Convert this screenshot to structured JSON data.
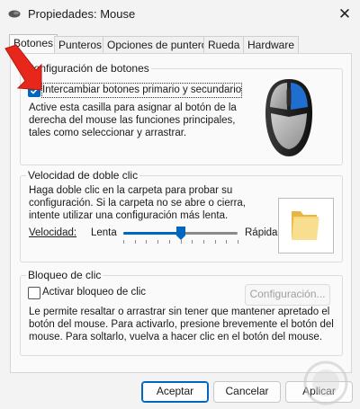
{
  "window": {
    "title": "Propiedades: Mouse",
    "close_glyph": "✕"
  },
  "tabs": [
    {
      "label": "Botones",
      "active": true
    },
    {
      "label": "Punteros",
      "active": false
    },
    {
      "label": "Opciones de puntero",
      "active": false
    },
    {
      "label": "Rueda",
      "active": false
    },
    {
      "label": "Hardware",
      "active": false
    }
  ],
  "buttons_config": {
    "group_title": "Configuración de botones",
    "swap_checkbox_label": "Intercambiar botones primario y secundario",
    "swap_checked": true,
    "description": [
      "Active esta casilla para asignar al botón de la",
      "derecha del mouse las funciones principales,",
      "tales como seleccionar y arrastrar."
    ]
  },
  "double_click": {
    "group_title": "Velocidad de doble clic",
    "description": [
      "Haga doble clic en la carpeta para probar su",
      "configuración. Si la carpeta no se abre o cierra,",
      "intente utilizar una configuración más lenta."
    ],
    "speed_label": "Velocidad:",
    "slow_label": "Lenta",
    "fast_label": "Rápida",
    "speed_fraction": 0.5
  },
  "click_lock": {
    "group_title": "Bloqueo de clic",
    "checkbox_label": "Activar bloqueo de clic",
    "checked": false,
    "settings_button": "Configuración...",
    "description": [
      "Le permite resaltar o arrastrar sin tener que mantener apretado el",
      "botón del mouse. Para activarlo, presione brevemente el botón del",
      "mouse. Para soltarlo, vuelva a hacer clic en el botón del mouse."
    ]
  },
  "footer": {
    "accept": "Aceptar",
    "cancel": "Cancelar",
    "apply": "Aplicar"
  },
  "colors": {
    "accent": "#0067c0",
    "annotation_arrow": "#e8271c"
  },
  "icons": [
    "mouse-icon",
    "close-icon",
    "mouse-illustration",
    "folder-icon",
    "red-arrow-annotation"
  ]
}
